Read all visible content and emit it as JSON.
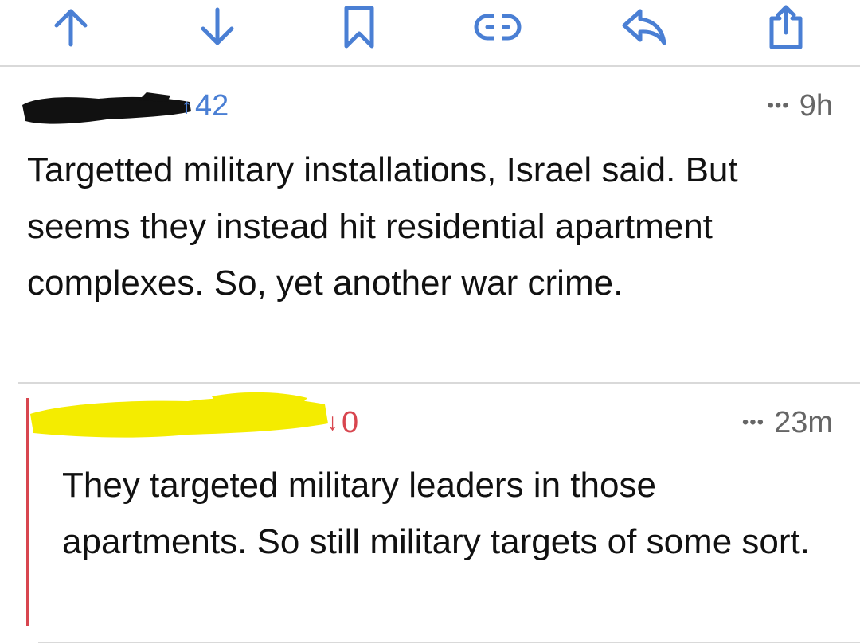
{
  "toolbar": {
    "accent": "#4a7fd4",
    "buttons": [
      {
        "icon": "upvote-arrow-icon"
      },
      {
        "icon": "downvote-arrow-icon"
      },
      {
        "icon": "bookmark-icon"
      },
      {
        "icon": "link-icon"
      },
      {
        "icon": "reply-icon"
      },
      {
        "icon": "share-icon"
      }
    ]
  },
  "comments": [
    {
      "vote_arrow": "↑",
      "score": "42",
      "score_color": "#4a7fd4",
      "more": "•••",
      "age": "9h",
      "text": "Targetted military installations, Israel said. But seems they instead hit residential apartment complexes. So, yet another war crime."
    },
    {
      "vote_arrow": "↓",
      "score": "0",
      "score_color": "#d8464f",
      "more": "•••",
      "age": "23m",
      "depth_bar_color": "#d8464f",
      "text": "They targeted military leaders in those apartments. So still military targets of some sort."
    }
  ]
}
